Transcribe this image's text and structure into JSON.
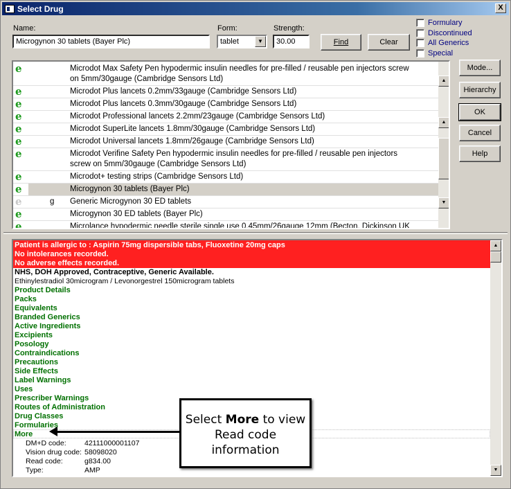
{
  "window": {
    "title": "Select Drug",
    "close_label": "X"
  },
  "search": {
    "name_label": "Name:",
    "name_value": "Microgynon 30 tablets (Bayer Plc)",
    "form_label": "Form:",
    "form_value": "tablet",
    "strength_label": "Strength:",
    "strength_value": "30.00",
    "find_label": "Find",
    "clear_label": "Clear"
  },
  "filters": [
    {
      "label": "Formulary"
    },
    {
      "label": "Discontinued"
    },
    {
      "label": "All Generics"
    },
    {
      "label": "Special"
    }
  ],
  "side_buttons": {
    "mode": "Mode...",
    "hierarchy": "Hierarchy",
    "ok": "OK",
    "cancel": "Cancel",
    "help": "Help"
  },
  "drug_list": [
    {
      "icon": "e",
      "prefix": "",
      "line1": "Microdot Max Safety Pen hypodermic insulin needles for pre-filled / reusable pen injectors screw",
      "line2": "on 5mm/30gauge (Cambridge Sensors Ltd)"
    },
    {
      "icon": "e",
      "prefix": "",
      "line1": "Microdot Plus lancets 0.2mm/33gauge (Cambridge Sensors Ltd)",
      "line2": ""
    },
    {
      "icon": "e",
      "prefix": "",
      "line1": "Microdot Plus lancets 0.3mm/30gauge (Cambridge Sensors Ltd)",
      "line2": ""
    },
    {
      "icon": "e",
      "prefix": "",
      "line1": "Microdot Professional lancets 2.2mm/23gauge (Cambridge Sensors Ltd)",
      "line2": ""
    },
    {
      "icon": "e",
      "prefix": "",
      "line1": "Microdot SuperLite lancets 1.8mm/30gauge (Cambridge Sensors Ltd)",
      "line2": ""
    },
    {
      "icon": "e",
      "prefix": "",
      "line1": "Microdot Universal lancets 1.8mm/26gauge (Cambridge Sensors Ltd)",
      "line2": ""
    },
    {
      "icon": "e",
      "prefix": "",
      "line1": "Microdot Verifine Safety Pen hypodermic insulin needles for pre-filled / reusable pen injectors",
      "line2": "screw on 5mm/30gauge (Cambridge Sensors Ltd)"
    },
    {
      "icon": "e",
      "prefix": "",
      "line1": "Microdot+ testing strips (Cambridge Sensors Ltd)",
      "line2": ""
    },
    {
      "icon": "e",
      "prefix": "",
      "line1": "Microgynon 30 tablets (Bayer Plc)",
      "line2": "",
      "selected": true
    },
    {
      "icon": "e-grey",
      "prefix": "g",
      "line1": "Generic Microgynon 30 ED tablets",
      "line2": ""
    },
    {
      "icon": "e",
      "prefix": "",
      "line1": "Microgynon 30 ED tablets (Bayer Plc)",
      "line2": ""
    },
    {
      "icon": "e",
      "prefix": "",
      "line1": "Microlance hypodermic needle sterile single use 0.45mm/26gauge 12mm (Becton, Dickinson UK",
      "line2": ""
    }
  ],
  "info": {
    "alerts": [
      "Patient is allergic to : Aspirin 75mg dispersible tabs, Fluoxetine 20mg caps",
      "No intolerances recorded.",
      "No adverse effects recorded."
    ],
    "status": "NHS, DOH Approved, Contraceptive, Generic Available.",
    "ingredients": "Ethinylestradiol 30microgram / Levonorgestrel 150microgram tablets",
    "sections": [
      "Product Details",
      "Packs",
      "Equivalents",
      "Branded Generics",
      "Active Ingredients",
      "Excipients",
      "Posology",
      "Contraindications",
      "Precautions",
      "Side Effects",
      "Label Warnings",
      "Uses",
      "Prescriber Warnings",
      "Routes of Administration",
      "Drug Classes",
      "Formularies",
      "More"
    ],
    "codes": [
      {
        "key": "DM+D code:",
        "value": "42111000001107"
      },
      {
        "key": "Vision drug code:",
        "value": "58098020"
      },
      {
        "key": "Read code:",
        "value": "g834.00"
      },
      {
        "key": "Type:",
        "value": "AMP"
      }
    ]
  },
  "callout": {
    "pre": "Select ",
    "bold": "More",
    "post": " to view Read code information"
  },
  "colors": {
    "alert_bg": "#ff2020",
    "link_green": "#007000",
    "title_blue": "#0a246a",
    "e_icon_green": "#1e9a1e"
  }
}
